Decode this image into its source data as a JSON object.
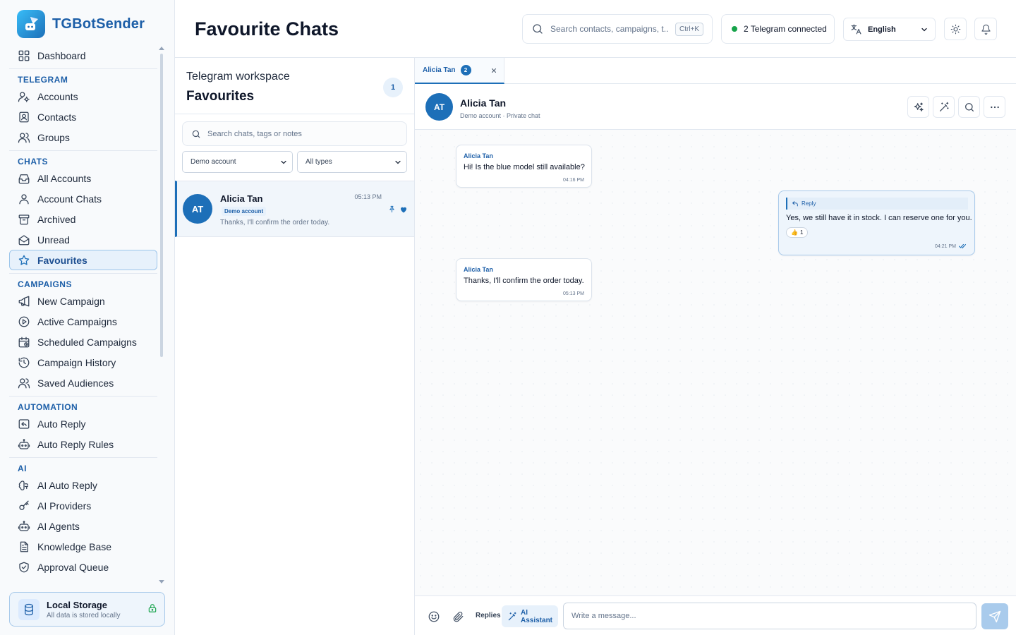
{
  "app": {
    "name": "TGBotSender"
  },
  "sidebar": {
    "top": [
      {
        "label": "Dashboard",
        "icon": "dashboard-icon"
      }
    ],
    "sections": [
      {
        "title": "TELEGRAM",
        "items": [
          {
            "label": "Accounts",
            "icon": "user-gear-icon"
          },
          {
            "label": "Contacts",
            "icon": "contact-card-icon"
          },
          {
            "label": "Groups",
            "icon": "users-icon"
          }
        ]
      },
      {
        "title": "CHATS",
        "items": [
          {
            "label": "All Accounts",
            "icon": "inbox-icon"
          },
          {
            "label": "Account Chats",
            "icon": "user-icon"
          },
          {
            "label": "Archived",
            "icon": "archive-icon"
          },
          {
            "label": "Unread",
            "icon": "mail-open-icon"
          },
          {
            "label": "Favourites",
            "icon": "star-icon",
            "active": true
          }
        ]
      },
      {
        "title": "CAMPAIGNS",
        "items": [
          {
            "label": "New Campaign",
            "icon": "megaphone-icon"
          },
          {
            "label": "Active Campaigns",
            "icon": "play-circle-icon"
          },
          {
            "label": "Scheduled Campaigns",
            "icon": "calendar-clock-icon"
          },
          {
            "label": "Campaign History",
            "icon": "history-icon"
          },
          {
            "label": "Saved Audiences",
            "icon": "users-icon"
          }
        ]
      },
      {
        "title": "AUTOMATION",
        "items": [
          {
            "label": "Auto Reply",
            "icon": "reply-box-icon"
          },
          {
            "label": "Auto Reply Rules",
            "icon": "bot-icon"
          }
        ]
      },
      {
        "title": "AI",
        "items": [
          {
            "label": "AI Auto Reply",
            "icon": "brain-icon"
          },
          {
            "label": "AI Providers",
            "icon": "key-icon"
          },
          {
            "label": "AI Agents",
            "icon": "bot-icon"
          },
          {
            "label": "Knowledge Base",
            "icon": "document-icon"
          },
          {
            "label": "Approval Queue",
            "icon": "shield-check-icon"
          }
        ]
      }
    ],
    "storage": {
      "title": "Local Storage",
      "subtitle": "All data is stored locally"
    }
  },
  "header": {
    "title": "Favourite Chats",
    "search_placeholder": "Search contacts, campaigns, t...",
    "search_shortcut": "Ctrl+K",
    "telegram_status": "2 Telegram connected",
    "language": "English"
  },
  "chat_list": {
    "subtitle": "Telegram workspace",
    "title": "Favourites",
    "count": "1",
    "search_placeholder": "Search chats, tags or notes",
    "account_filter": "Demo account",
    "type_filter": "All types",
    "chats": [
      {
        "initials": "AT",
        "name": "Alicia Tan",
        "time": "05:13 PM",
        "badge": "Demo account",
        "preview": "Thanks, I'll confirm the order today."
      }
    ]
  },
  "conversation": {
    "tab": {
      "label": "Alicia Tan",
      "count": "2"
    },
    "contact": {
      "initials": "AT",
      "name": "Alicia Tan",
      "subtitle": "Demo account · Private chat"
    },
    "messages": [
      {
        "direction": "in",
        "sender": "Alicia Tan",
        "text": "Hi! Is the blue model still available?",
        "time": "04:16 PM"
      },
      {
        "direction": "out",
        "reply_label": "Reply",
        "text": "Yes, we still have it in stock. I can reserve one for you.",
        "reaction": "👍",
        "reaction_count": "1",
        "time": "04:21 PM"
      },
      {
        "direction": "in",
        "sender": "Alicia Tan",
        "text": "Thanks, I'll confirm the order today.",
        "time": "05:13 PM"
      }
    ],
    "composer": {
      "replies_label": "Replies",
      "ai_label": "AI Assistant",
      "placeholder": "Write a message..."
    }
  },
  "colors": {
    "accent": "#1d6fb8",
    "brand_text": "#1d5fa8",
    "online": "#16a34a"
  }
}
